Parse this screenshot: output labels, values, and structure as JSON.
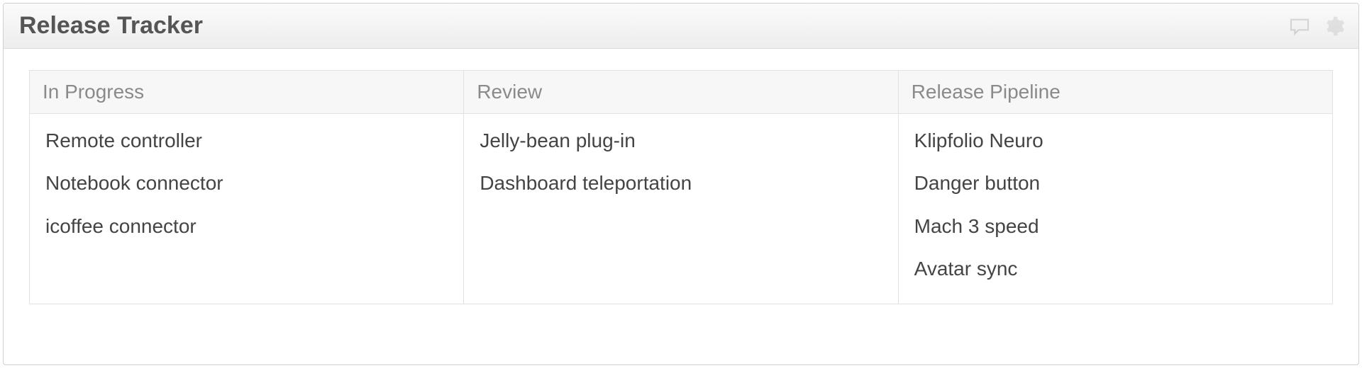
{
  "header": {
    "title": "Release Tracker"
  },
  "columns": [
    {
      "label": "In Progress",
      "items": [
        "Remote controller",
        "Notebook connector",
        "icoffee connector"
      ]
    },
    {
      "label": "Review",
      "items": [
        "Jelly-bean plug-in",
        "Dashboard teleportation"
      ]
    },
    {
      "label": "Release Pipeline",
      "items": [
        "Klipfolio Neuro",
        "Danger button",
        "Mach 3 speed",
        "Avatar sync"
      ]
    }
  ]
}
